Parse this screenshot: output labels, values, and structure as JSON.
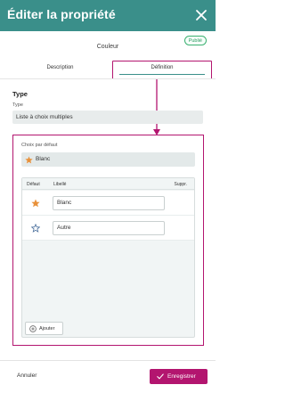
{
  "header": {
    "title": "Éditer la propriété",
    "close_icon": "close-icon"
  },
  "property": {
    "name": "Couleur",
    "status": "Publié"
  },
  "tabs": [
    {
      "label": "Description",
      "active": false
    },
    {
      "label": "Définition",
      "active": true
    }
  ],
  "type_section": {
    "title": "Type",
    "field_label": "Type",
    "value": "Liste à choix multiples"
  },
  "default_choice": {
    "label": "Choix par défaut",
    "value": "Blanc",
    "icon": "star-filled-icon"
  },
  "choices_table": {
    "headers": {
      "default": "Défaut",
      "label": "Libellé",
      "delete": "Suppr."
    },
    "rows": [
      {
        "label": "Blanc",
        "is_default": true
      },
      {
        "label": "Autre",
        "is_default": false
      }
    ],
    "add_label": "Ajouter"
  },
  "footer": {
    "cancel_label": "Annuler",
    "save_label": "Enregistrer"
  },
  "colors": {
    "header_bg": "#3a8f8a",
    "accent_magenta": "#b3156f",
    "star_orange": "#e8913a",
    "status_green": "#2e9a62"
  }
}
